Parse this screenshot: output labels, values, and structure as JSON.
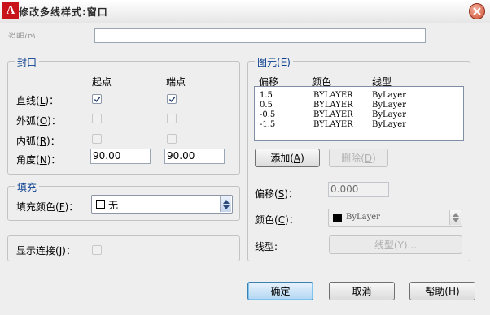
{
  "window": {
    "title": "修改多线样式:窗口",
    "app_icon": "A",
    "close_icon": "close-icon"
  },
  "description": {
    "label": "说明(P):",
    "value": ""
  },
  "caps": {
    "legend": "封口",
    "col_start": "起点",
    "col_end": "端点",
    "rows": [
      {
        "label": "直线",
        "key": "L",
        "start": true,
        "end": true,
        "enabled": true
      },
      {
        "label": "外弧",
        "key": "O",
        "start": false,
        "end": false,
        "enabled": false
      },
      {
        "label": "内弧",
        "key": "R",
        "start": false,
        "end": false,
        "enabled": false
      }
    ],
    "angle": {
      "label": "角度",
      "key": "N",
      "start": "90.00",
      "end": "90.00"
    }
  },
  "fill": {
    "legend": "填充",
    "label": "填充颜色",
    "key": "F",
    "value": "无",
    "swatch_color": "#ffffff"
  },
  "joints": {
    "label": "显示连接",
    "key": "J",
    "checked": false
  },
  "elements": {
    "legend": "图元",
    "legend_key": "E",
    "headers": [
      "偏移",
      "颜色",
      "线型"
    ],
    "rows": [
      {
        "offset": "1.5",
        "color": "BYLAYER",
        "linetype": "ByLayer"
      },
      {
        "offset": "0.5",
        "color": "BYLAYER",
        "linetype": "ByLayer"
      },
      {
        "offset": "-0.5",
        "color": "BYLAYER",
        "linetype": "ByLayer"
      },
      {
        "offset": "-1.5",
        "color": "BYLAYER",
        "linetype": "ByLayer"
      }
    ],
    "add_label": "添加",
    "add_key": "A",
    "delete_label": "删除",
    "delete_key": "D",
    "offset_label": "偏移",
    "offset_key": "S",
    "offset_value": "0.000",
    "color_label": "颜色",
    "color_key": "C",
    "color_value": "ByLayer",
    "color_swatch": "#000000",
    "linetype_label": "线型:",
    "linetype_button": "线型(Y)..."
  },
  "footer": {
    "ok": "确定",
    "cancel": "取消",
    "help": "帮助",
    "help_key": "H"
  }
}
